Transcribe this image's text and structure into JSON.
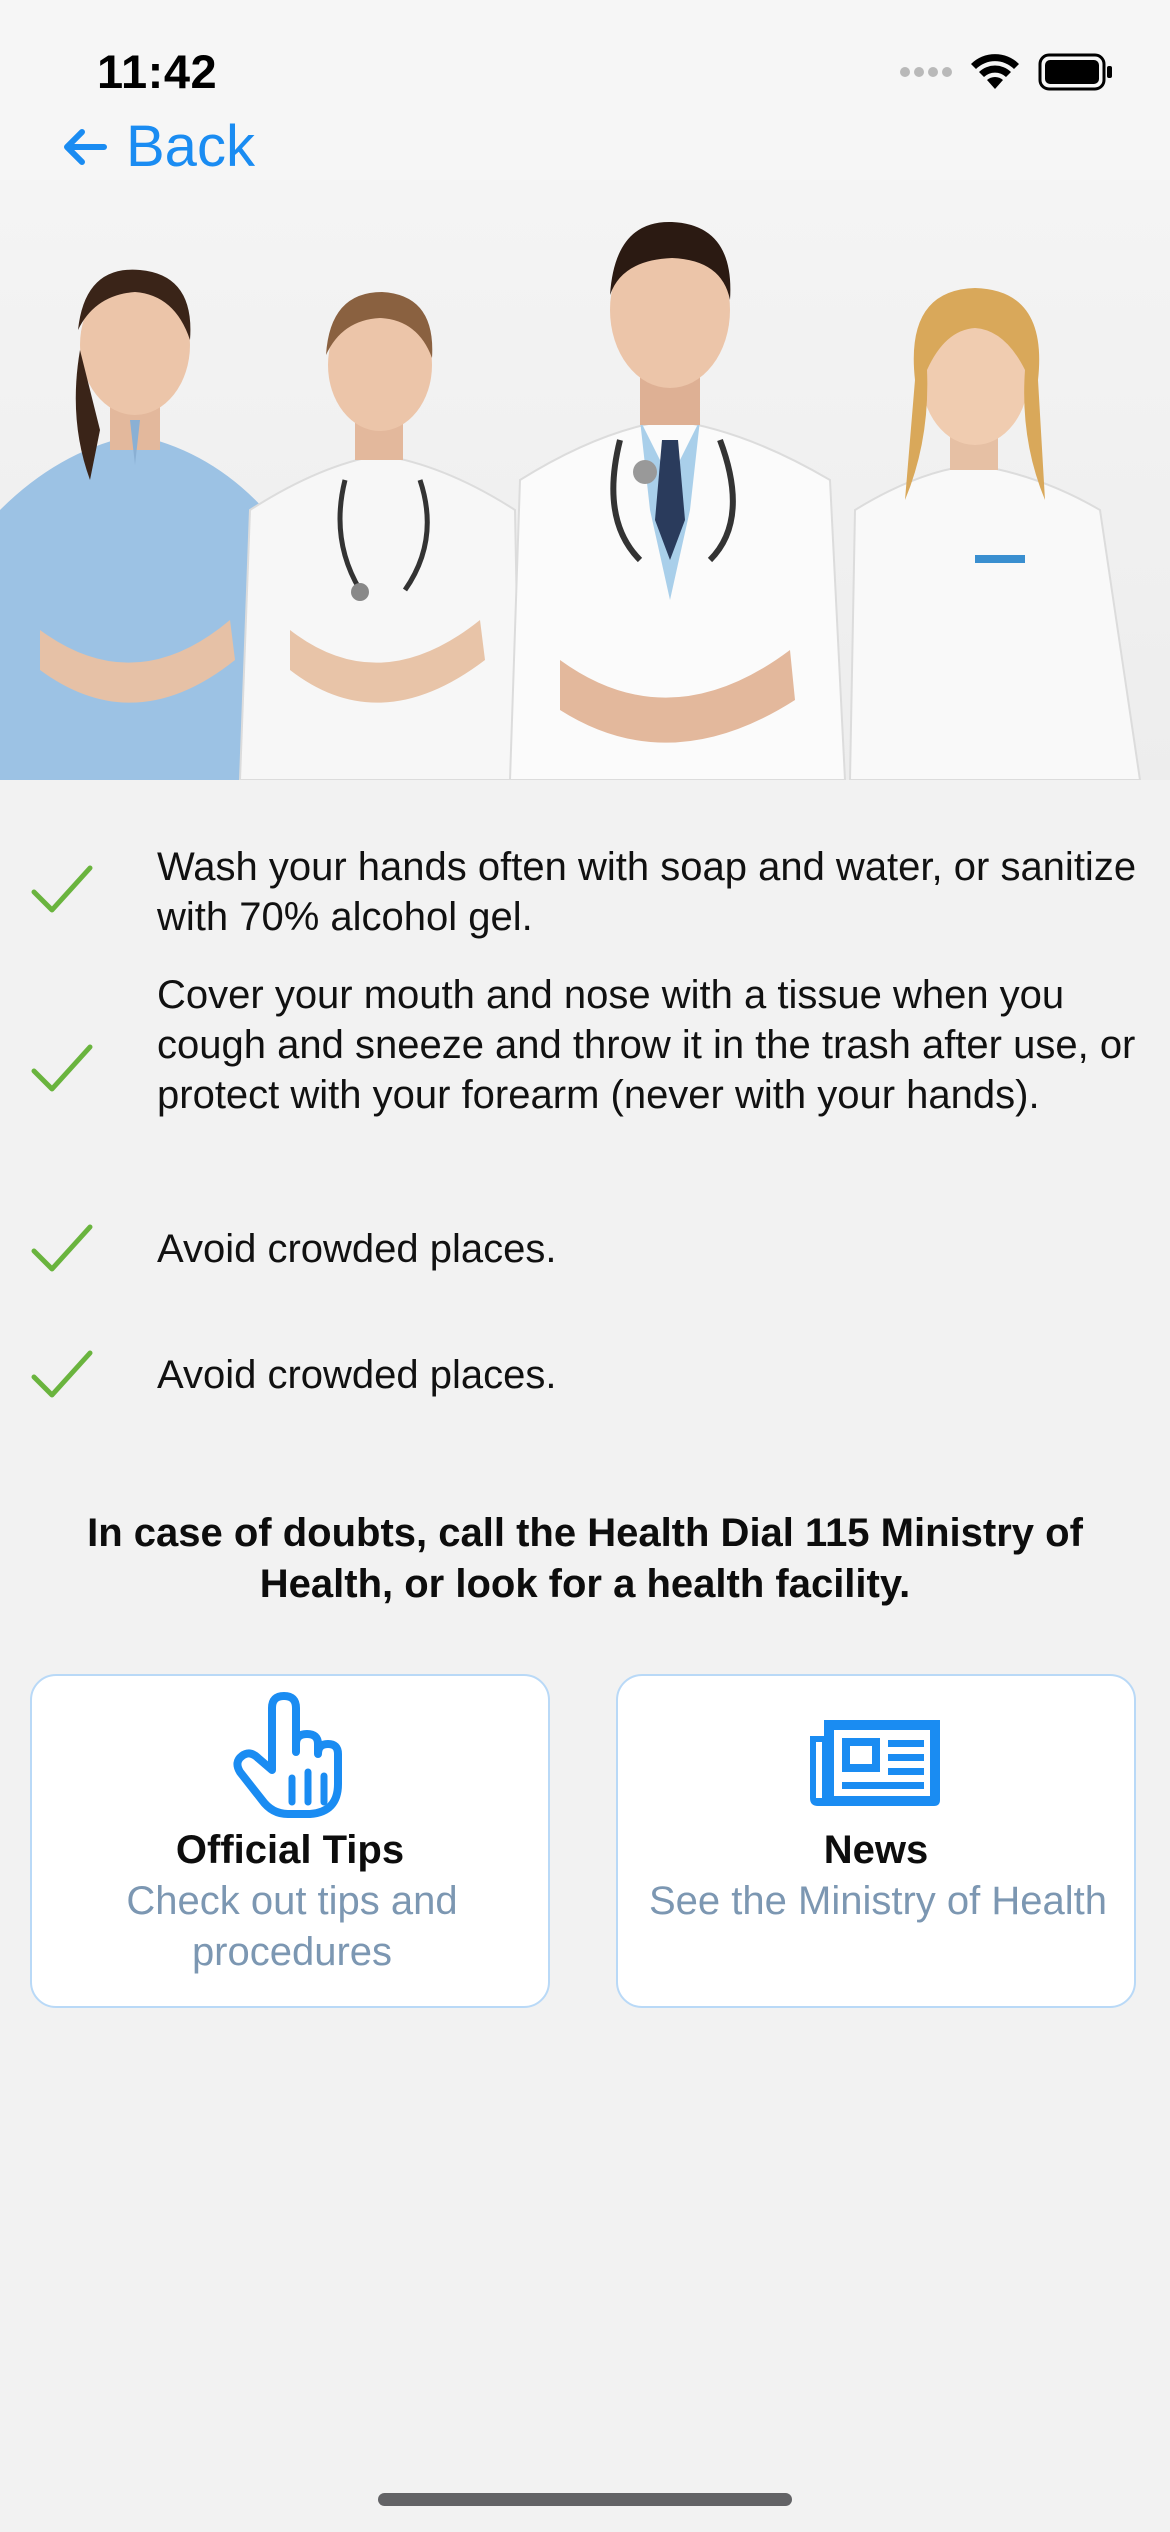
{
  "status_bar": {
    "time": "11:42",
    "icons": [
      "signal-icon",
      "wifi-icon",
      "battery-icon"
    ]
  },
  "nav": {
    "back_label": "Back",
    "back_icon": "arrow-left-icon",
    "accent_color": "#1a8cf2"
  },
  "hero": {
    "icon": "medical-team-photo"
  },
  "tips": [
    {
      "text": "Wash your hands often with soap and water, or sanitize with 70% alcohol gel."
    },
    {
      "text": "Cover your mouth and nose with a tissue when you cough and sneeze and throw it in the trash after use, or protect with your forearm (never with your hands)."
    },
    {
      "text": "Avoid crowded places."
    },
    {
      "text": "Avoid crowded places."
    }
  ],
  "check_color": "#6ab43e",
  "notice": "In case of doubts, call the Health Dial 115 Ministry of Health, or look for a health facility.",
  "cards": [
    {
      "title": "Official Tips",
      "subtitle": "Check out tips and procedures",
      "icon": "hand-pointer-icon"
    },
    {
      "title": "News",
      "subtitle": "See the Ministry of Health",
      "icon": "newspaper-icon"
    }
  ]
}
